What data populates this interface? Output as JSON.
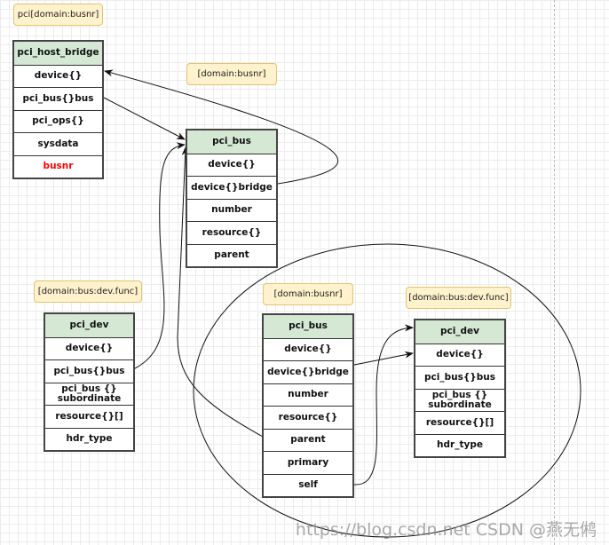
{
  "notes": {
    "host": "pci[domain:busnr]",
    "bus1": "[domain:busnr]",
    "dev1": "[domain:bus:dev.func]",
    "bus2": "[domain:busnr]",
    "dev2": "[domain:bus:dev.func]"
  },
  "host_bridge": {
    "title": "pci_host_bridge",
    "rows": [
      "device{}",
      "pci_bus{}bus",
      "pci_ops{}",
      "sysdata",
      "busnr"
    ]
  },
  "pci_bus_1": {
    "title": "pci_bus",
    "rows": [
      "device{}",
      "device{}bridge",
      "number",
      "resource{}",
      "parent"
    ]
  },
  "pci_dev_1": {
    "title": "pci_dev",
    "rows": [
      "device{}",
      "pci_bus{}bus",
      "pci_bus {} subordinate",
      "resource{}[]",
      "hdr_type"
    ]
  },
  "pci_bus_2": {
    "title": "pci_bus",
    "rows": [
      "device{}",
      "device{}bridge",
      "number",
      "resource{}",
      "parent",
      "primary",
      "self"
    ]
  },
  "pci_dev_2": {
    "title": "pci_dev",
    "rows": [
      "device{}",
      "pci_bus{}bus",
      "pci_bus {} subordinate",
      "resource{}[]",
      "hdr_type"
    ]
  },
  "watermark": "https://blog.csdn.net CSDN @燕无鸺",
  "colors": {
    "header": "#d5e8d4",
    "note": "#fff2cc",
    "highlight": "#ff0000"
  }
}
